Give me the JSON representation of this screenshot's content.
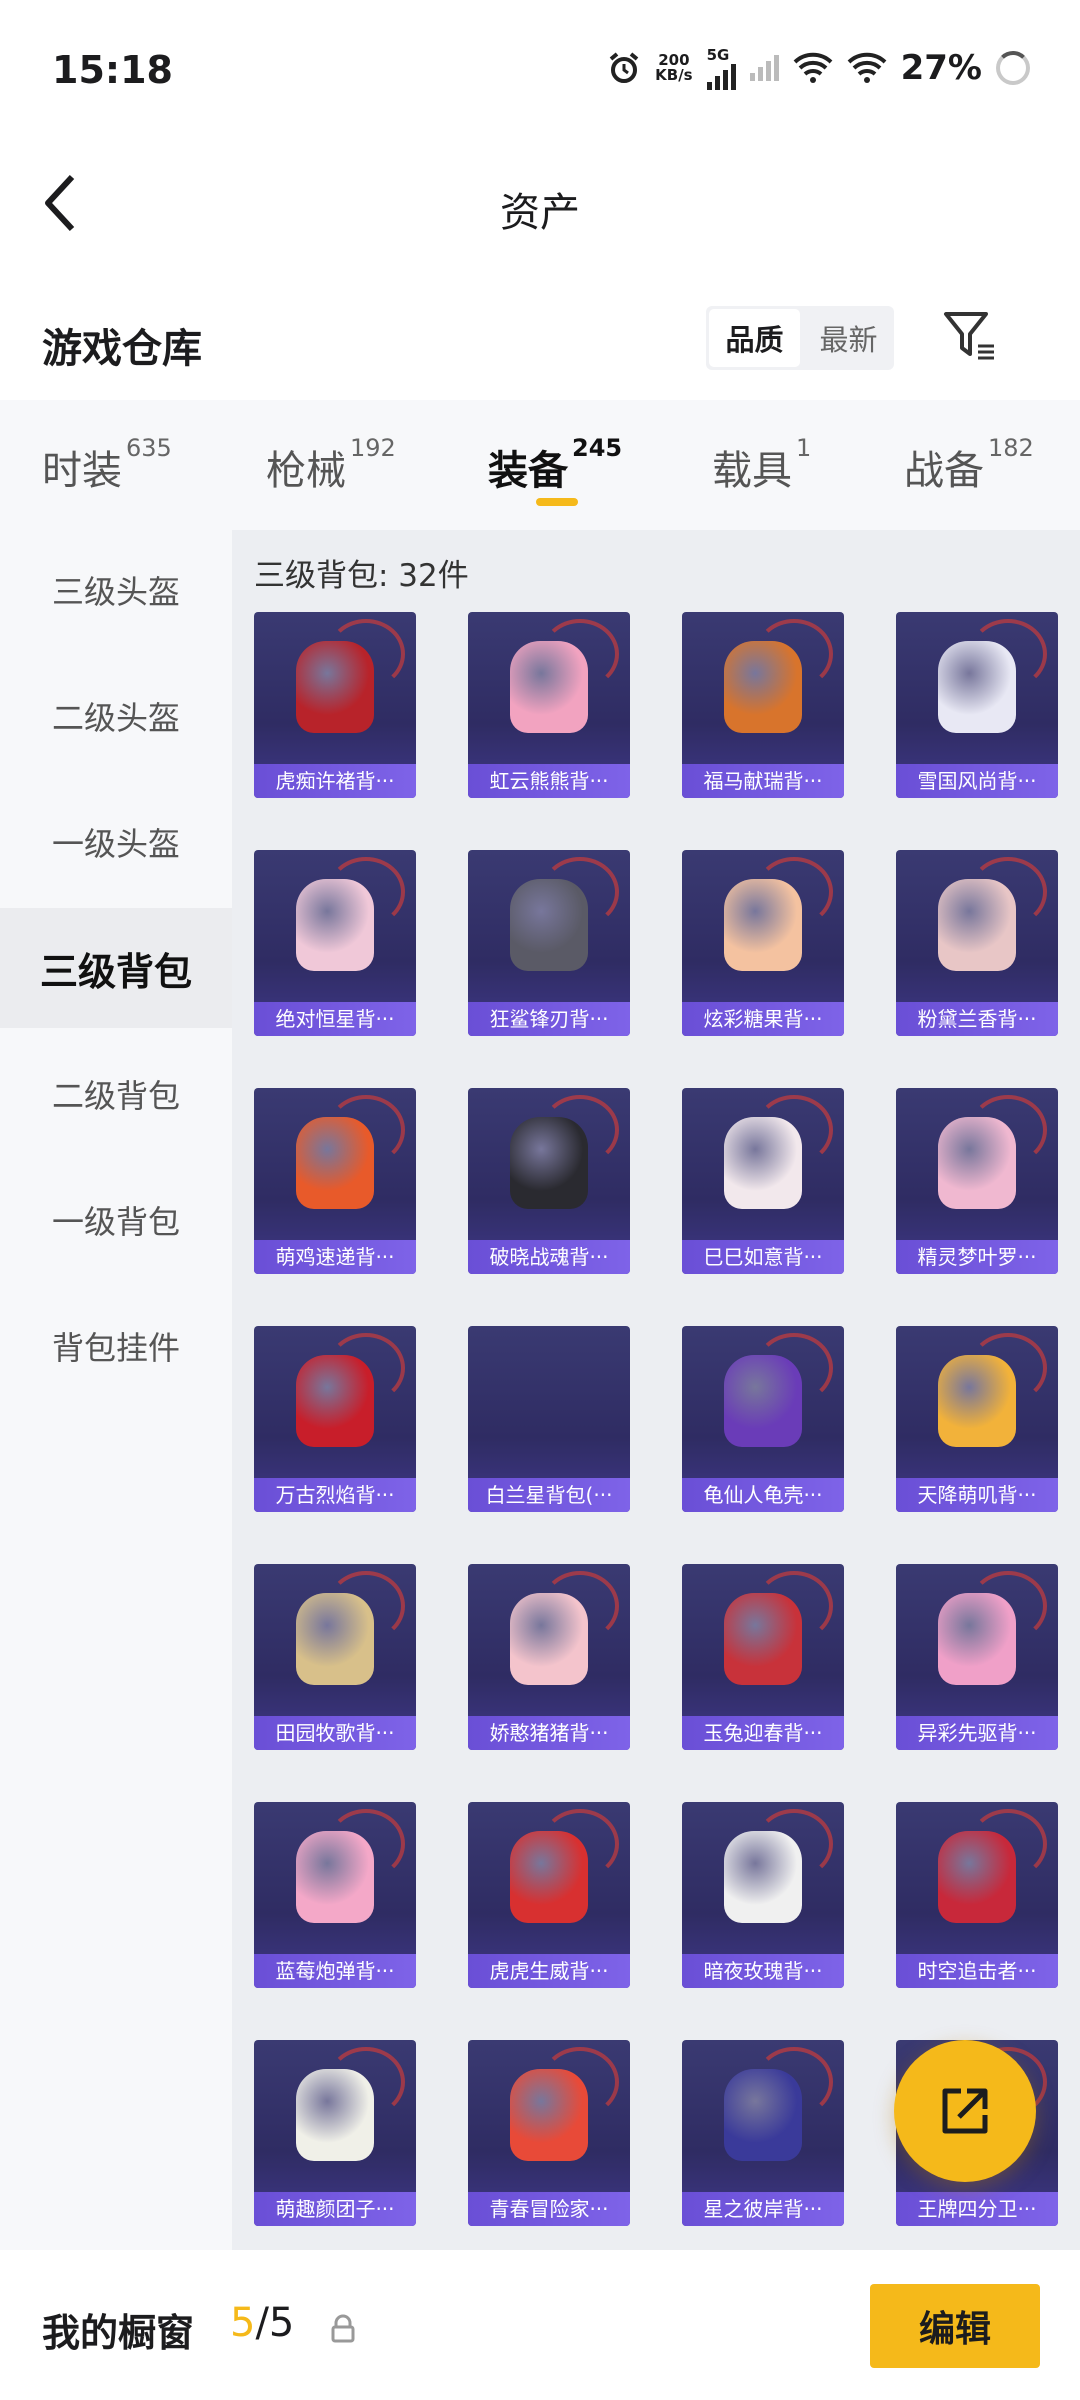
{
  "status_bar": {
    "time": "15:18",
    "net_speed_value": "200",
    "net_speed_unit": "KB/s",
    "network": "5G",
    "battery": "27%"
  },
  "header": {
    "title": "资产"
  },
  "section": {
    "title": "游戏仓库",
    "sort_options": [
      "品质",
      "最新"
    ],
    "sort_selected": "品质"
  },
  "tabs": [
    {
      "label": "时装",
      "count": "635"
    },
    {
      "label": "枪械",
      "count": "192"
    },
    {
      "label": "装备",
      "count": "245",
      "active": true
    },
    {
      "label": "载具",
      "count": "1"
    },
    {
      "label": "战备",
      "count": "182"
    }
  ],
  "sidebar": [
    {
      "label": "三级头盔"
    },
    {
      "label": "二级头盔"
    },
    {
      "label": "一级头盔"
    },
    {
      "label": "三级背包",
      "active": true
    },
    {
      "label": "二级背包"
    },
    {
      "label": "一级背包"
    },
    {
      "label": "背包挂件"
    }
  ],
  "content": {
    "count_text": "三级背包: 32件",
    "items": [
      {
        "name": "虎痴许褚背···",
        "color": "#b8232a"
      },
      {
        "name": "虹云熊熊背···",
        "color": "#f2a3c0"
      },
      {
        "name": "福马献瑞背···",
        "color": "#d8742c"
      },
      {
        "name": "雪国风尚背···",
        "color": "#e8e8f4"
      },
      {
        "name": "绝对恒星背···",
        "color": "#f0c8d8"
      },
      {
        "name": "狂鲨锋刃背···",
        "color": "#5a5a66"
      },
      {
        "name": "炫彩糖果背···",
        "color": "#f4c2a0"
      },
      {
        "name": "粉黛兰香背···",
        "color": "#e8c6c6"
      },
      {
        "name": "萌鸡速递背···",
        "color": "#e85a2a"
      },
      {
        "name": "破晓战魂背···",
        "color": "#2a2a30"
      },
      {
        "name": "巳巳如意背···",
        "color": "#f2e8ec"
      },
      {
        "name": "精灵梦叶罗···",
        "color": "#f0b8d0"
      },
      {
        "name": "万古烈焰背···",
        "color": "#c81e2a"
      },
      {
        "name": "白兰星背包(···",
        "color": ""
      },
      {
        "name": "龟仙人龟壳···",
        "color": "#6a3cb8"
      },
      {
        "name": "天降萌叽背···",
        "color": "#f2b23a"
      },
      {
        "name": "田园牧歌背···",
        "color": "#d8c08a"
      },
      {
        "name": "娇憨猪猪背···",
        "color": "#f4c4cc"
      },
      {
        "name": "玉兔迎春背···",
        "color": "#c8323a"
      },
      {
        "name": "异彩先驱背···",
        "color": "#f0a0c8"
      },
      {
        "name": "蓝莓炮弹背···",
        "color": "#f4a8c8"
      },
      {
        "name": "虎虎生威背···",
        "color": "#d83030"
      },
      {
        "name": "暗夜玫瑰背···",
        "color": "#f0f0f0"
      },
      {
        "name": "时空追击者···",
        "color": "#c8283a"
      },
      {
        "name": "萌趣颜团子···",
        "color": "#f0f0e8"
      },
      {
        "name": "青春冒险家···",
        "color": "#e84a38"
      },
      {
        "name": "星之彼岸背···",
        "color": "#3a3a9a"
      },
      {
        "name": "王牌四分卫···",
        "color": "#d82a2a"
      }
    ]
  },
  "bottom": {
    "label": "我的橱窗",
    "current": "5",
    "total": "/5",
    "edit_label": "编辑"
  },
  "colors": {
    "accent": "#f5b91a",
    "card_label": "#6a4fd6"
  }
}
